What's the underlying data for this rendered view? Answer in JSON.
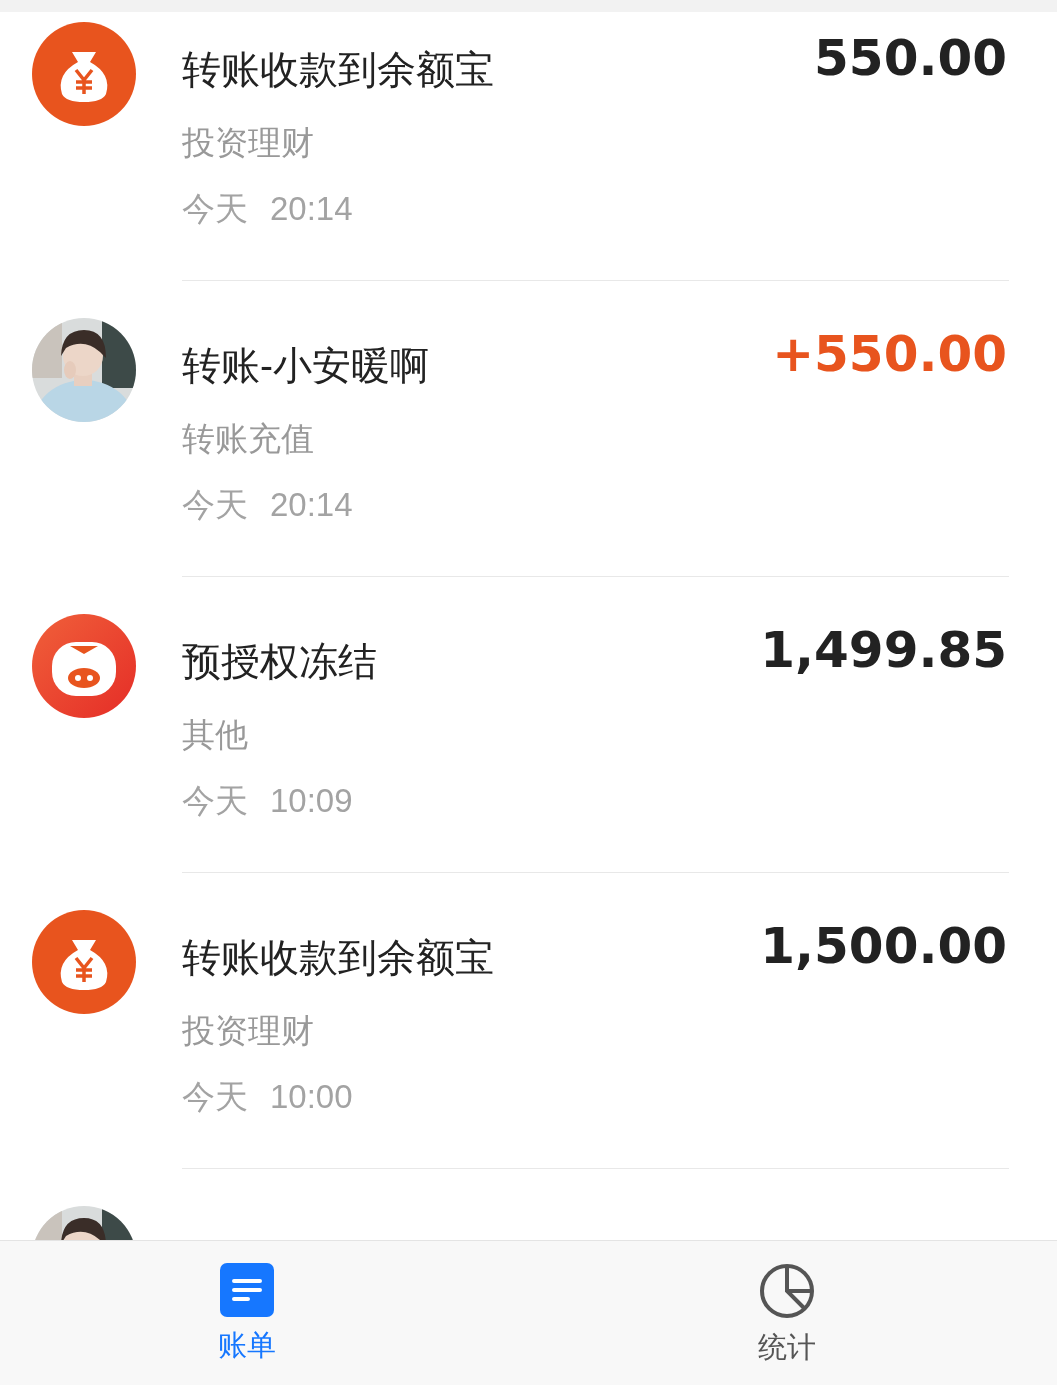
{
  "transactions": [
    {
      "kind": "money-bag",
      "title": "转账收款到余额宝",
      "category": "投资理财",
      "day": "今天",
      "time": "20:14",
      "amount": "550.00",
      "income": false
    },
    {
      "kind": "picture",
      "title": "转账-小安暖啊",
      "category": "转账充值",
      "day": "今天",
      "time": "20:14",
      "amount": "+550.00",
      "income": true
    },
    {
      "kind": "pig",
      "title": "预授权冻结",
      "category": "其他",
      "day": "今天",
      "time": "10:09",
      "amount": "1,499.85",
      "income": false
    },
    {
      "kind": "money-bag",
      "title": "转账收款到余额宝",
      "category": "投资理财",
      "day": "今天",
      "time": "10:00",
      "amount": "1,500.00",
      "income": false
    },
    {
      "kind": "picture"
    }
  ],
  "tabs": [
    {
      "kind": "bill",
      "label": "账单",
      "selected": true
    },
    {
      "kind": "pie",
      "label": "统计",
      "selected": false
    }
  ]
}
